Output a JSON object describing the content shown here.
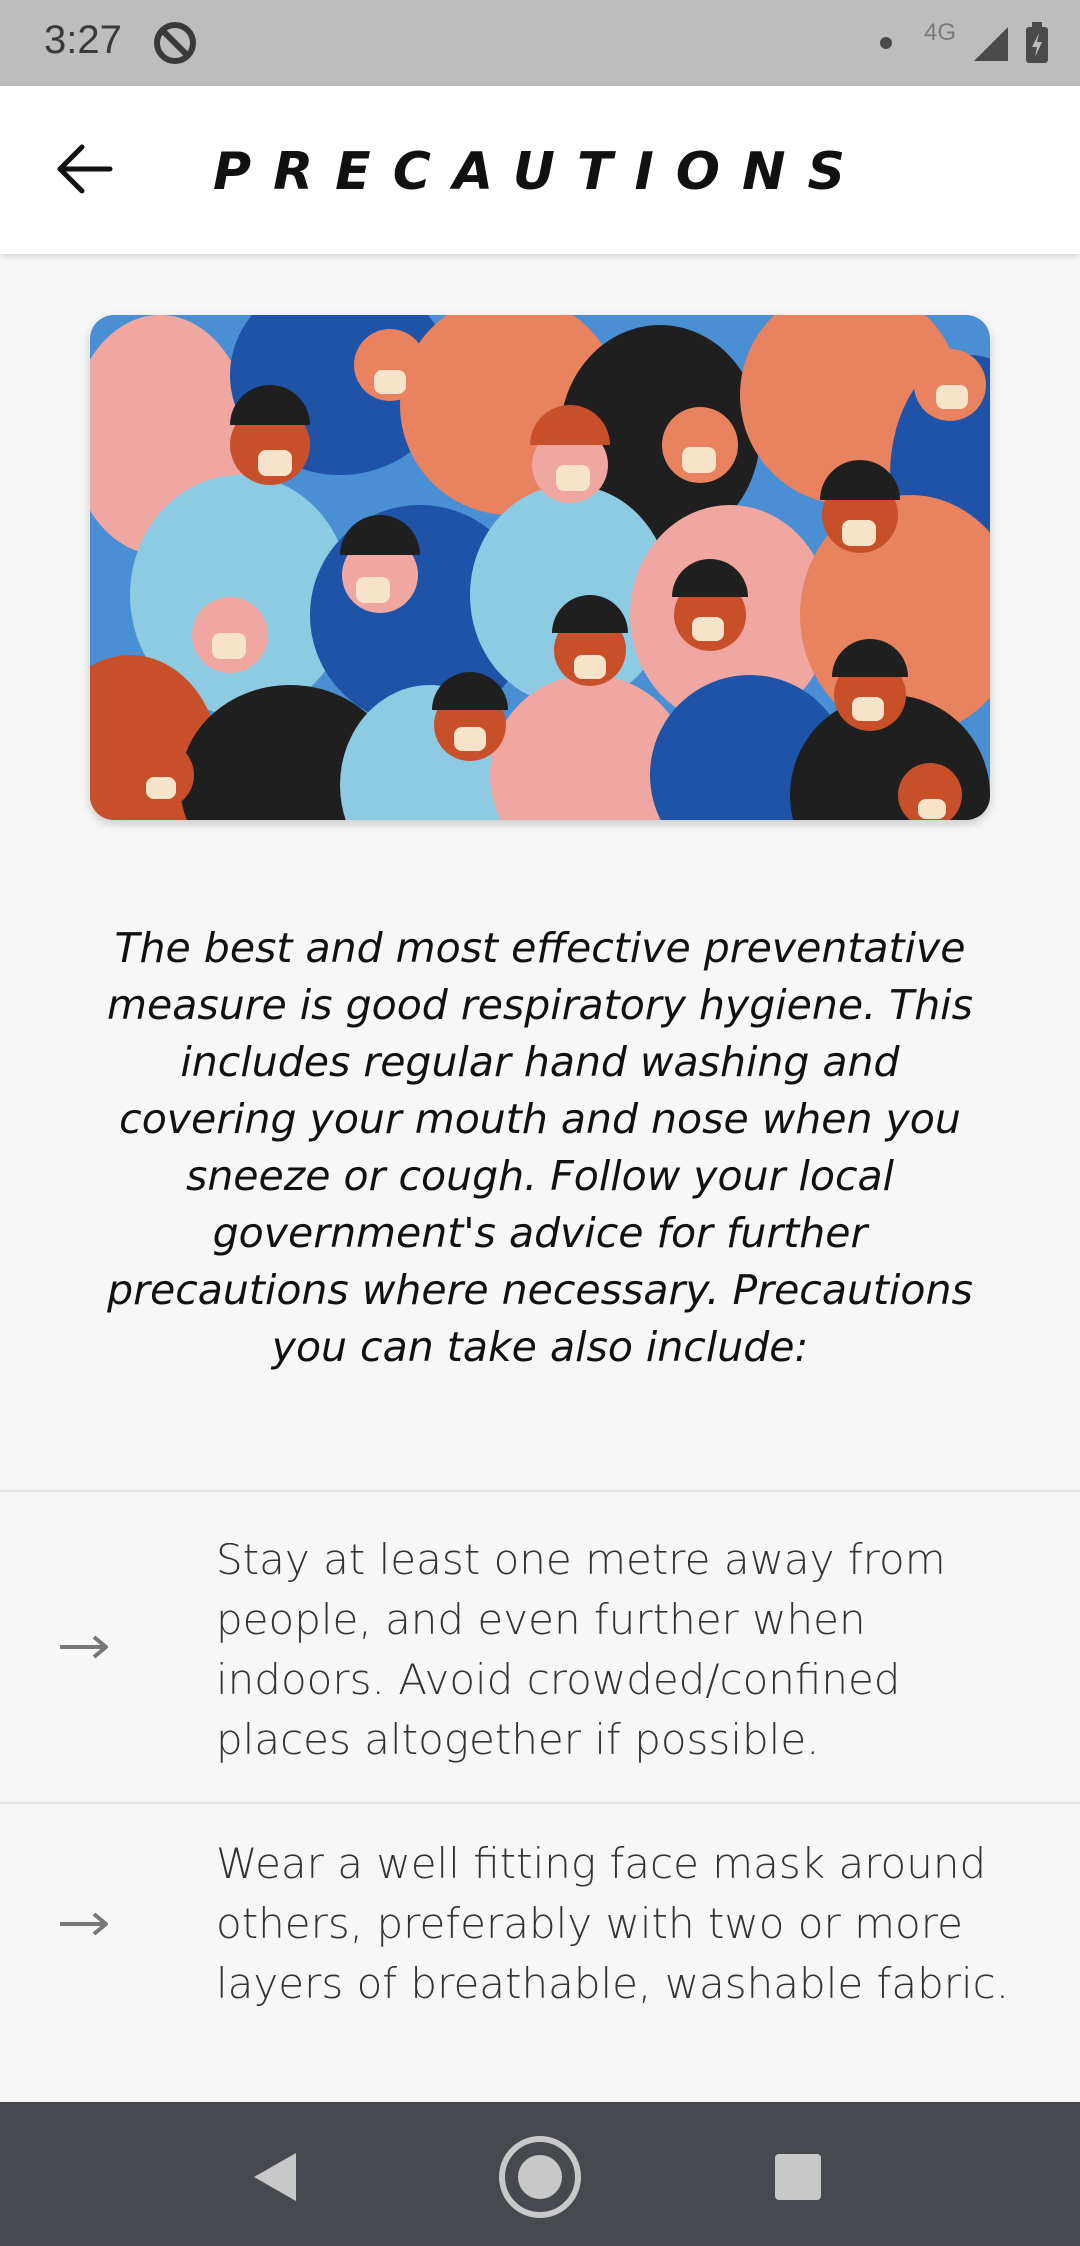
{
  "status_bar": {
    "time": "3:27",
    "network": "4G",
    "icons": [
      "do-not-disturb-icon",
      "signal-icon",
      "battery-charging-icon"
    ]
  },
  "app_bar": {
    "title": "PRECAUTIONS",
    "back_icon": "arrow-left-icon"
  },
  "hero": {
    "image": "crowd-wearing-face-masks-illustration",
    "colors": [
      "#4a8fd3",
      "#f0a6a1",
      "#e9825f",
      "#1f1f1f",
      "#8ccbe1",
      "#1e53a8",
      "#c7502b"
    ]
  },
  "intro": {
    "text": "The best and most effective preventative measure is good respiratory hygiene. This includes regular hand washing and covering your mouth and nose when you sneeze or cough. Follow your local government's advice for further precautions where necessary. Precautions you can take also include:"
  },
  "list": {
    "items": [
      {
        "icon": "arrow-right-icon",
        "text": "Stay at least one metre away from people, and even further when indoors. Avoid crowded/confined places altogether if possible."
      },
      {
        "icon": "arrow-right-icon",
        "text": "Wear a well fitting face mask around others, preferably with two or more layers of breathable, washable fabric."
      }
    ]
  },
  "nav_bar": {
    "buttons": [
      "back-triangle-icon",
      "home-circle-icon",
      "recents-square-icon"
    ]
  }
}
